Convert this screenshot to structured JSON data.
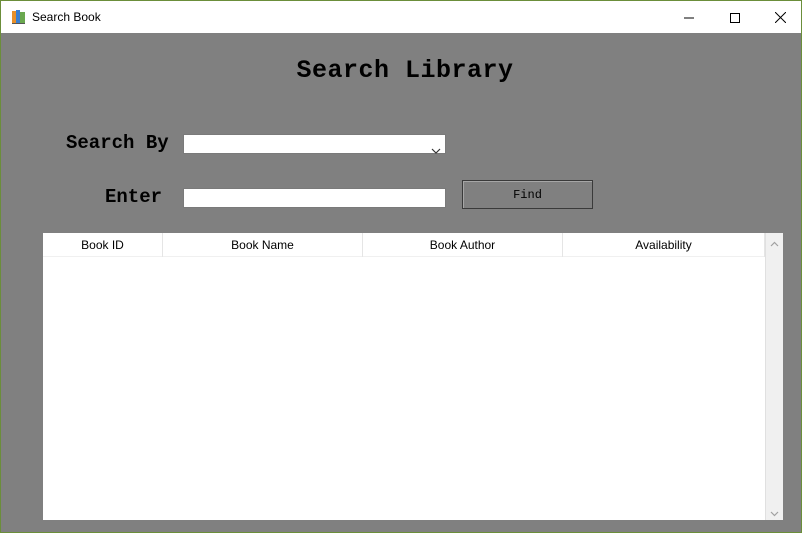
{
  "window": {
    "title": "Search Book",
    "app_icon": "books-icon"
  },
  "titlebar_controls": [
    "minimize-icon",
    "maximize-icon",
    "close-icon"
  ],
  "main": {
    "heading": "Search Library",
    "search_by_label": "Search By",
    "search_by_value": "",
    "enter_label": "Enter",
    "enter_value": "",
    "find_button": "Find"
  },
  "table": {
    "columns": [
      "Book ID",
      "Book Name",
      "Book Author",
      "Availability"
    ],
    "rows": []
  },
  "colors": {
    "background": "#808080",
    "field": "#ffffff"
  }
}
